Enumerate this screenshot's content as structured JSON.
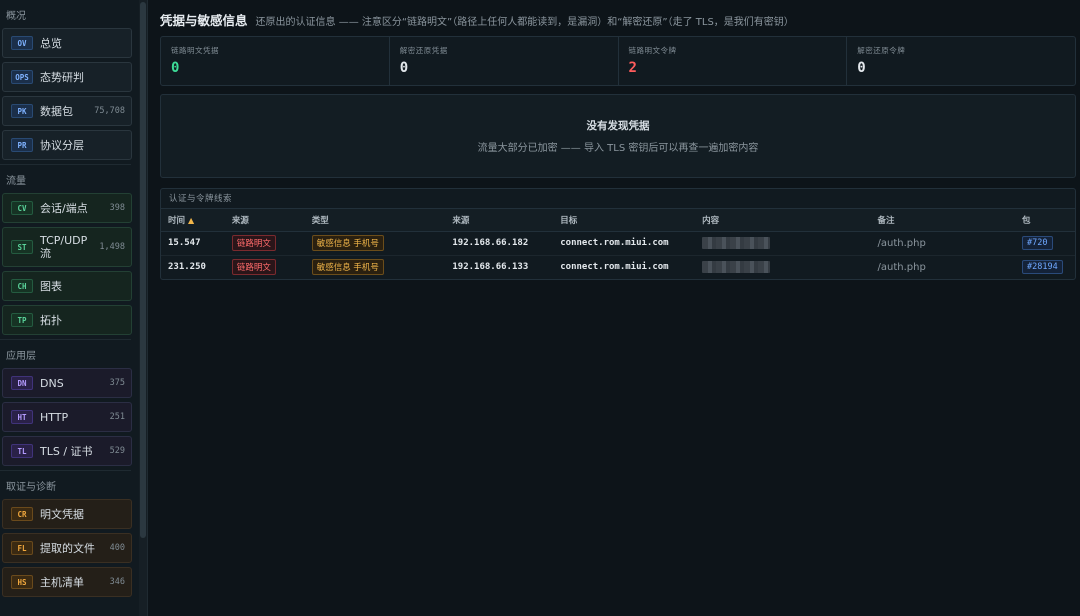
{
  "sidebar": {
    "groups": [
      {
        "title": "概况",
        "items": [
          {
            "badge": "OV",
            "label": "总览",
            "count": ""
          },
          {
            "badge": "OPS",
            "label": "态势研判",
            "count": ""
          },
          {
            "badge": "PK",
            "label": "数据包",
            "count": "75,708"
          },
          {
            "badge": "PR",
            "label": "协议分层",
            "count": ""
          }
        ]
      },
      {
        "title": "流量",
        "items": [
          {
            "badge": "CV",
            "label": "会话/端点",
            "count": "398"
          },
          {
            "badge": "ST",
            "label": "TCP/UDP 流",
            "count": "1,498"
          },
          {
            "badge": "CH",
            "label": "图表",
            "count": ""
          },
          {
            "badge": "TP",
            "label": "拓扑",
            "count": ""
          }
        ]
      },
      {
        "title": "应用层",
        "items": [
          {
            "badge": "DN",
            "label": "DNS",
            "count": "375"
          },
          {
            "badge": "HT",
            "label": "HTTP",
            "count": "251"
          },
          {
            "badge": "TL",
            "label": "TLS / 证书",
            "count": "529"
          }
        ]
      },
      {
        "title": "取证与诊断",
        "items": [
          {
            "badge": "CR",
            "label": "明文凭据",
            "count": ""
          },
          {
            "badge": "FL",
            "label": "提取的文件",
            "count": "400"
          },
          {
            "badge": "HS",
            "label": "主机清单",
            "count": "346"
          }
        ]
      }
    ]
  },
  "header": {
    "title": "凭据与敏感信息",
    "subtitle": "还原出的认证信息 —— 注意区分“链路明文”（路径上任何人都能读到，是漏洞）和“解密还原”（走了 TLS，是我们有密钥）"
  },
  "stats": [
    {
      "label": "链路明文凭据",
      "value": "0",
      "color": "#3ddc97"
    },
    {
      "label": "解密还原凭据",
      "value": "0",
      "color": "#e3e8ec"
    },
    {
      "label": "链路明文令牌",
      "value": "2",
      "color": "#ff5c5c"
    },
    {
      "label": "解密还原令牌",
      "value": "0",
      "color": "#e3e8ec"
    }
  ],
  "empty": {
    "title": "没有发现凭据",
    "desc": "流量大部分已加密 —— 导入 TLS 密钥后可以再查一遍加密内容"
  },
  "table": {
    "caption": "认证与令牌线索",
    "columns": [
      "时间",
      "来源",
      "类型",
      "来源",
      "目标",
      "内容",
      "备注",
      "包"
    ],
    "sort_indicator": "▲",
    "rows": [
      {
        "time": "15.547",
        "origin": "链路明文",
        "type": "敏感信息 手机号",
        "src": "192.168.66.182",
        "dst": "connect.rom.miui.com",
        "note": "/auth.php",
        "pkt": "#720"
      },
      {
        "time": "231.250",
        "origin": "链路明文",
        "type": "敏感信息 手机号",
        "src": "192.168.66.133",
        "dst": "connect.rom.miui.com",
        "note": "/auth.php",
        "pkt": "#28194"
      }
    ]
  }
}
